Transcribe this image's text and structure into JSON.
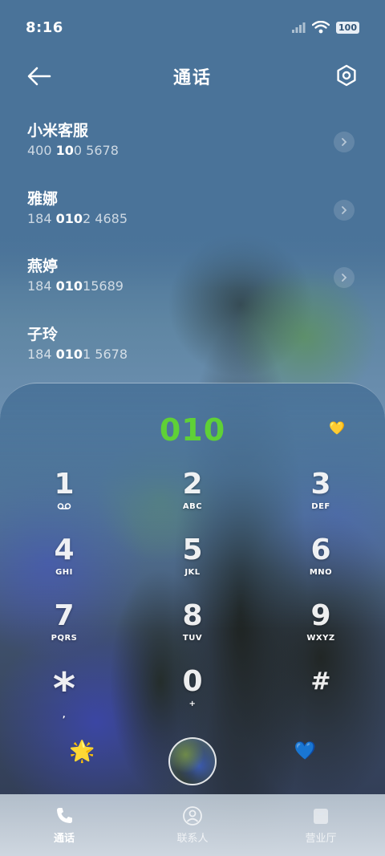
{
  "status": {
    "time": "8:16",
    "battery": "100"
  },
  "header": {
    "title": "通话"
  },
  "suggestions": [
    {
      "name": "小米客服",
      "number_parts": [
        "400 ",
        "10",
        "0 5678"
      ]
    },
    {
      "name": "雅娜",
      "number_parts": [
        "184 ",
        "010",
        "2 4685"
      ]
    },
    {
      "name": "燕婷",
      "number_parts": [
        "184 ",
        "010",
        "15689"
      ]
    },
    {
      "name": "子玲",
      "number_parts": [
        "184 ",
        "010",
        "1 5678"
      ]
    }
  ],
  "dialer": {
    "input": "010",
    "keys": [
      {
        "num": "1",
        "sub": ""
      },
      {
        "num": "2",
        "sub": "ABC"
      },
      {
        "num": "3",
        "sub": "DEF"
      },
      {
        "num": "4",
        "sub": "GHI"
      },
      {
        "num": "5",
        "sub": "JKL"
      },
      {
        "num": "6",
        "sub": "MNO"
      },
      {
        "num": "7",
        "sub": "PQRS"
      },
      {
        "num": "8",
        "sub": "TUV"
      },
      {
        "num": "9",
        "sub": "WXYZ"
      },
      {
        "num": "*",
        "sub": ","
      },
      {
        "num": "0",
        "sub": "+"
      },
      {
        "num": "#",
        "sub": ""
      }
    ]
  },
  "bottom_nav": [
    {
      "label": "通话",
      "icon": "phone-icon",
      "active": true
    },
    {
      "label": "联系人",
      "icon": "person-icon",
      "active": false
    },
    {
      "label": "营业厅",
      "icon": "store-icon",
      "active": false
    }
  ],
  "colors": {
    "accent_green": "#5fd136",
    "background_blue": "#4a7399"
  }
}
